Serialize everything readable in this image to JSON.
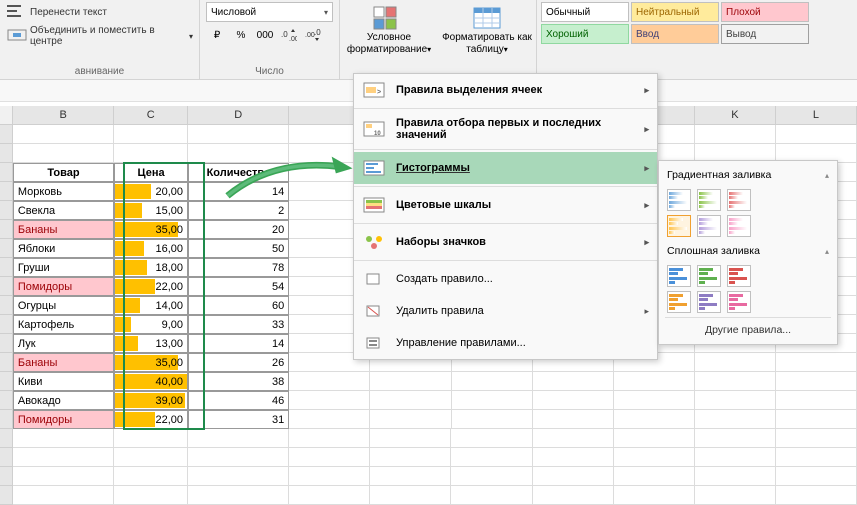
{
  "ribbon": {
    "wrap_text": "Перенести текст",
    "merge_center": "Объединить и поместить в центре",
    "align_label": "авнивание",
    "number_format": "Числовой",
    "number_label": "Число",
    "currency_sym": "₽",
    "percent_sym": "%",
    "thousands_sym": "000",
    "cond_format": "Условное форматирование",
    "as_table": "Форматировать как таблицу",
    "styles": {
      "normal": "Обычный",
      "neutral": "Нейтральный",
      "bad": "Плохой",
      "good": "Хороший",
      "input": "Ввод",
      "output": "Вывод"
    }
  },
  "columns": [
    "B",
    "C",
    "D",
    "",
    "",
    "",
    "",
    "",
    "K",
    "L"
  ],
  "table": {
    "headers": {
      "tovar": "Товар",
      "price": "Цена",
      "qty": "Количество"
    },
    "rows": [
      {
        "name": "Морковь",
        "price": "20,00",
        "qty": "14",
        "bar": 50,
        "hl": false
      },
      {
        "name": "Свекла",
        "price": "15,00",
        "qty": "2",
        "bar": 37,
        "hl": false
      },
      {
        "name": "Бананы",
        "price": "35,00",
        "qty": "20",
        "bar": 87,
        "hl": true
      },
      {
        "name": "Яблоки",
        "price": "16,00",
        "qty": "50",
        "bar": 40,
        "hl": false
      },
      {
        "name": "Груши",
        "price": "18,00",
        "qty": "78",
        "bar": 45,
        "hl": false
      },
      {
        "name": "Помидоры",
        "price": "22,00",
        "qty": "54",
        "bar": 55,
        "hl": true
      },
      {
        "name": "Огурцы",
        "price": "14,00",
        "qty": "60",
        "bar": 35,
        "hl": false
      },
      {
        "name": "Картофель",
        "price": "9,00",
        "qty": "33",
        "bar": 22,
        "hl": false
      },
      {
        "name": "Лук",
        "price": "13,00",
        "qty": "14",
        "bar": 32,
        "hl": false
      },
      {
        "name": "Бананы",
        "price": "35,00",
        "qty": "26",
        "bar": 87,
        "hl": true
      },
      {
        "name": "Киви",
        "price": "40,00",
        "qty": "38",
        "bar": 100,
        "hl": false
      },
      {
        "name": "Авокадо",
        "price": "39,00",
        "qty": "46",
        "bar": 97,
        "hl": false
      },
      {
        "name": "Помидоры",
        "price": "22,00",
        "qty": "31",
        "bar": 55,
        "hl": true
      }
    ]
  },
  "dropdown": {
    "highlight_rules": "Правила выделения ячеек",
    "top_bottom": "Правила отбора первых и последних значений",
    "data_bars": "Гистограммы",
    "color_scales": "Цветовые шкалы",
    "icon_sets": "Наборы значков",
    "new_rule": "Создать правило...",
    "clear_rules": "Удалить правила",
    "manage_rules": "Управление правилами..."
  },
  "submenu": {
    "gradient_fill": "Градиентная заливка",
    "solid_fill": "Сплошная заливка",
    "more_rules": "Другие правила...",
    "gradient_colors": [
      "#6fa8dc",
      "#8bc34a",
      "#e57373",
      "#ffc34d",
      "#b39ddb",
      "#f8a0c8"
    ],
    "solid_colors": [
      "#4a90d9",
      "#5fb04f",
      "#d9534f",
      "#f0a030",
      "#8e7cc3",
      "#e86aa1"
    ]
  }
}
